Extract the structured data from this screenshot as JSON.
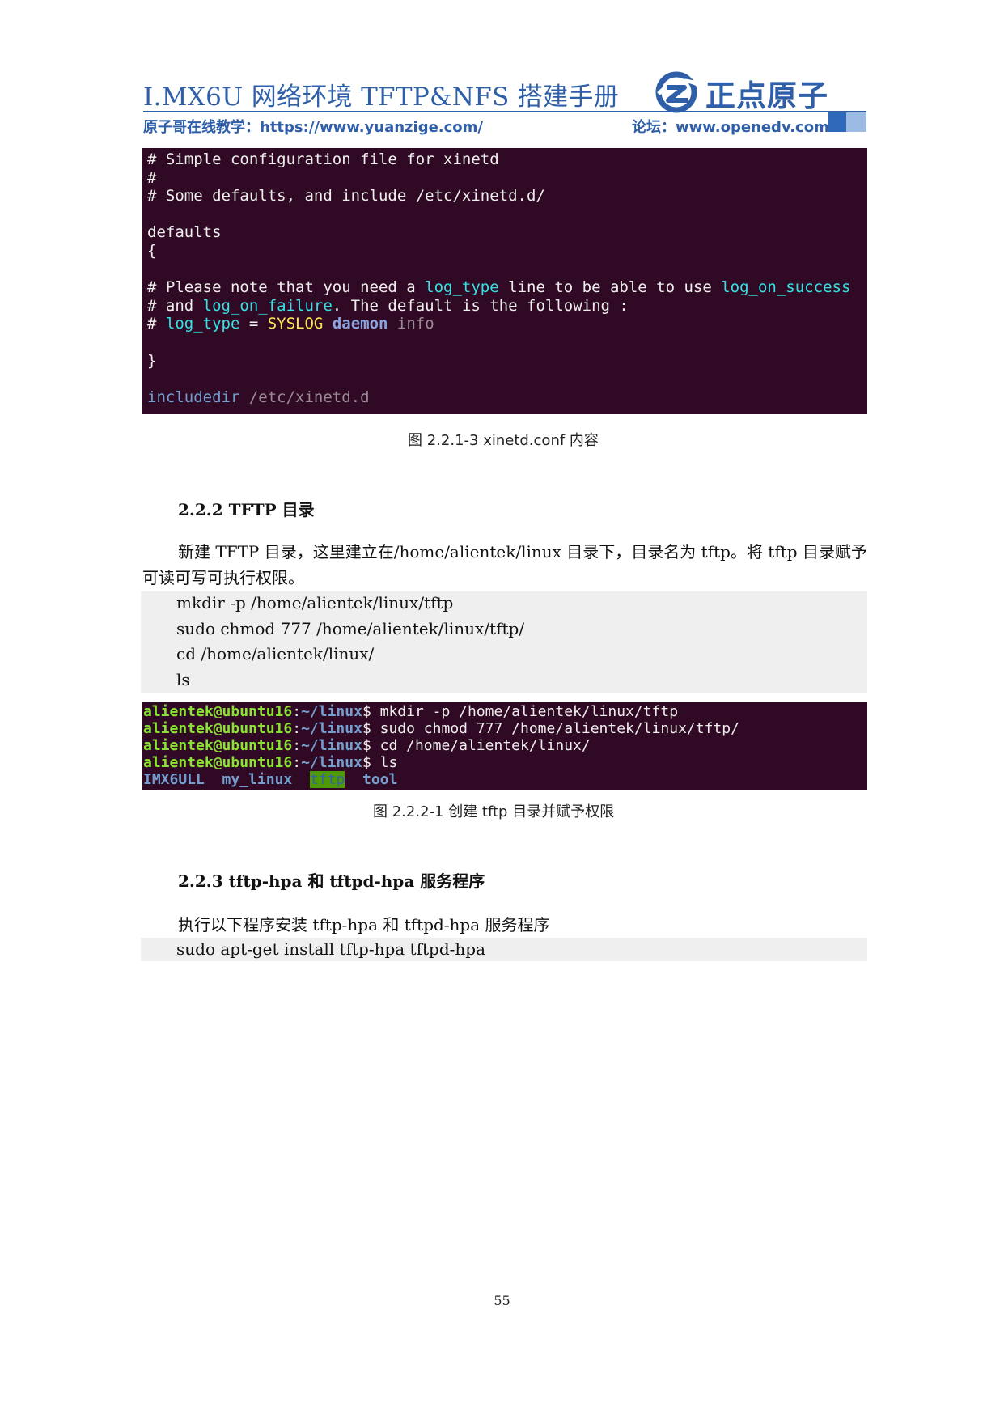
{
  "header": {
    "title": "I.MX6U 网络环境 TFTP&NFS 搭建手册",
    "logo_text": "正点原子",
    "subtitle_left": "原子哥在线教学：https://www.yuanzige.com/",
    "subtitle_right": "论坛：www.openedv.com",
    "brand_color": "#2e5fa8"
  },
  "terminal1": {
    "l1": "# Simple configuration file for xinetd",
    "l2": "#",
    "l3": "# Some defaults, and include /etc/xinetd.d/",
    "l5": "defaults",
    "l6": "{",
    "l8a": "# Please note that you need a ",
    "l8b": "log_type",
    "l8c": " line to be able to use ",
    "l8d": "log_on_success",
    "l9a": "# and ",
    "l9b": "log_on_failure",
    "l9c": ". The default is the following :",
    "l10a": "# ",
    "l10b": "log_type",
    "l10c": " = ",
    "l10d": "SYSLOG",
    "l10e": " daemon",
    "l10f": " info",
    "l12": "}",
    "l14a": "includedir",
    "l14b": " /etc/xinetd.d"
  },
  "caption1": "图 2.2.1-3 xinetd.conf 内容",
  "section222": {
    "heading": "2.2.2 TFTP 目录",
    "para_line1": "新建 TFTP 目录，这里建立在/home/alientek/linux 目录下，目录名为 tftp。将 tftp 目录赋予",
    "para_line2": "可读可写可执行权限。",
    "code": [
      "mkdir -p /home/alientek/linux/tftp",
      "sudo chmod 777 /home/alientek/linux/tftp/",
      "cd /home/alientek/linux/",
      "ls"
    ]
  },
  "terminal2": {
    "user": "alientek@ubuntu16",
    "colon": ":",
    "path": "~/linux",
    "dollar": "$",
    "cmd1": " mkdir -p /home/alientek/linux/tftp",
    "cmd2": " sudo chmod 777 /home/alientek/linux/tftp/",
    "cmd3": " cd /home/alientek/linux/",
    "cmd4": " ls",
    "ls_1": "IMX6ULL",
    "ls_gap1": "  ",
    "ls_2": "my_linux",
    "ls_gap2": "  ",
    "ls_3": "tftp",
    "ls_gap3": "  ",
    "ls_4": "tool"
  },
  "caption2": "图 2.2.2-1 创建 tftp 目录并赋予权限",
  "section223": {
    "heading": "2.2.3 tftp-hpa 和 tftpd-hpa 服务程序",
    "para": "执行以下程序安装 tftp-hpa 和 tftpd-hpa 服务程序",
    "code": "sudo apt-get install tftp-hpa tftpd-hpa"
  },
  "page_number": "55"
}
